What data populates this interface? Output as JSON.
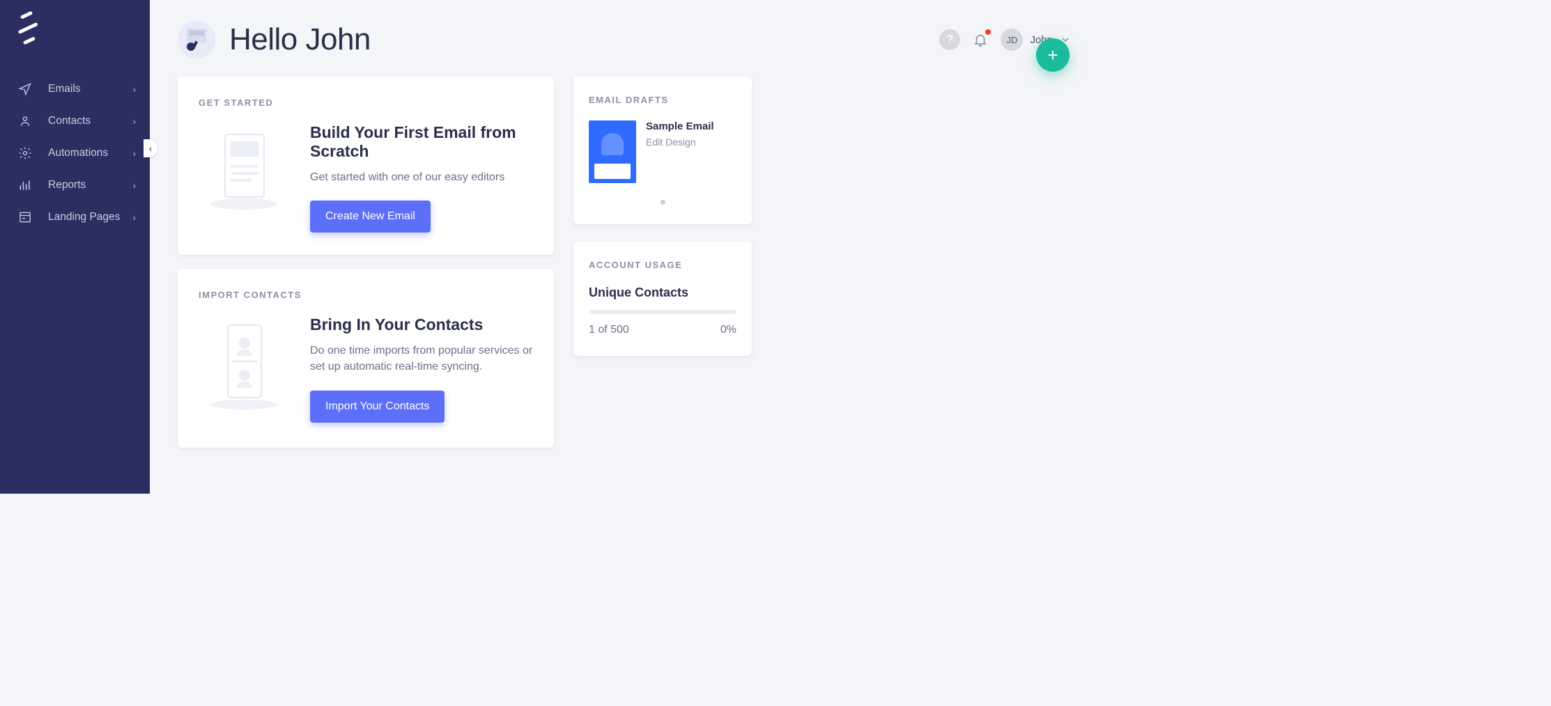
{
  "sidebar": {
    "items": [
      {
        "label": "Emails"
      },
      {
        "label": "Contacts"
      },
      {
        "label": "Automations"
      },
      {
        "label": "Reports"
      },
      {
        "label": "Landing Pages"
      }
    ]
  },
  "header": {
    "greeting": "Hello John",
    "user": {
      "initials": "JD",
      "name": "John"
    }
  },
  "cards": {
    "getStarted": {
      "kicker": "GET STARTED",
      "title": "Build Your First Email from Scratch",
      "text": "Get started with one of our easy editors",
      "cta": "Create New Email"
    },
    "importContacts": {
      "kicker": "IMPORT CONTACTS",
      "title": "Bring In Your Contacts",
      "text": "Do one time imports from popular services or set up automatic real-time syncing.",
      "cta": "Import Your Contacts"
    }
  },
  "drafts": {
    "kicker": "EMAIL DRAFTS",
    "items": [
      {
        "title": "Sample Email",
        "action": "Edit Design"
      }
    ]
  },
  "usage": {
    "kicker": "ACCOUNT USAGE",
    "metric": "Unique Contacts",
    "count": "1 of 500",
    "pct": "0%"
  }
}
